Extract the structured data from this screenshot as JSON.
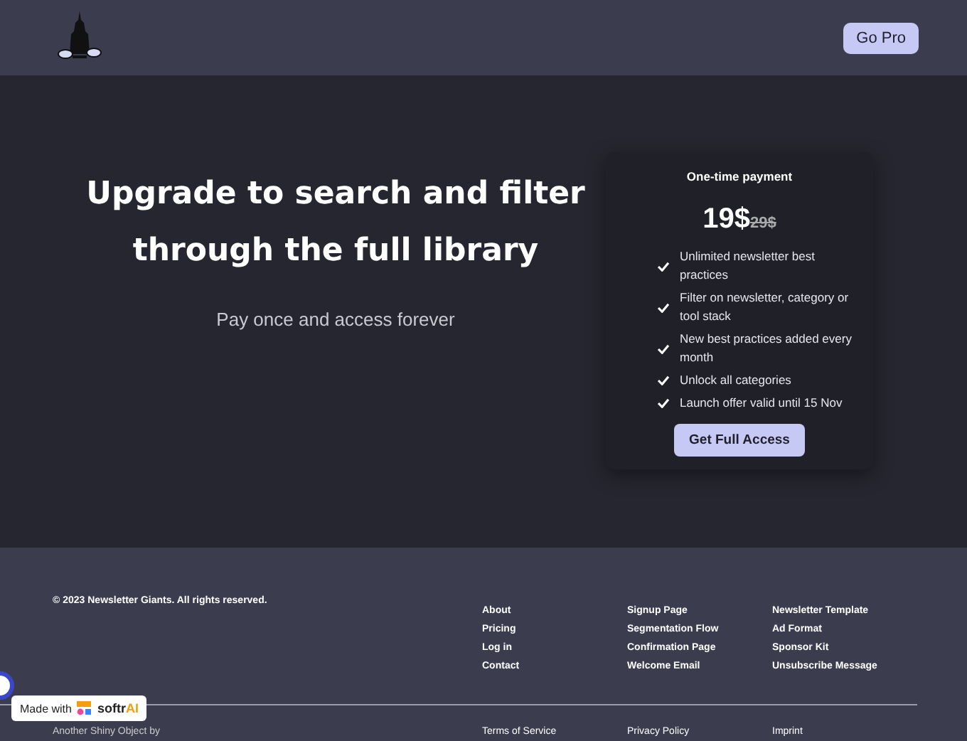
{
  "header": {
    "button": "Go Pro"
  },
  "hero": {
    "title": "Upgrade to search and filter through the full library",
    "subtitle": "Pay once and access forever"
  },
  "card": {
    "label": "One-time payment",
    "price": "19$",
    "old_price": "29$",
    "features": [
      "Unlimited newsletter best practices",
      "Filter on newsletter, category or tool stack",
      "New best practices added every month",
      "Unlock all categories",
      "Launch offer valid until 15 Nov"
    ],
    "button": "Get Full Access"
  },
  "footer": {
    "copyright": "© 2023 Newsletter Giants. All rights reserved.",
    "columns": [
      [
        "About",
        "Pricing",
        "Log in",
        "Contact"
      ],
      [
        "Signup Page",
        "Segmentation Flow",
        "Confirmation Page",
        "Welcome Email"
      ],
      [
        "Newsletter Template",
        "Ad Format",
        "Sponsor Kit",
        "Unsubscribe Message"
      ]
    ],
    "credit": "Another Shiny Object by",
    "legal": [
      "Terms of Service",
      "Privacy Policy",
      "Imprint"
    ]
  },
  "badge": {
    "prefix": "Made with",
    "brand": "softr",
    "brand_suffix": "AI"
  }
}
